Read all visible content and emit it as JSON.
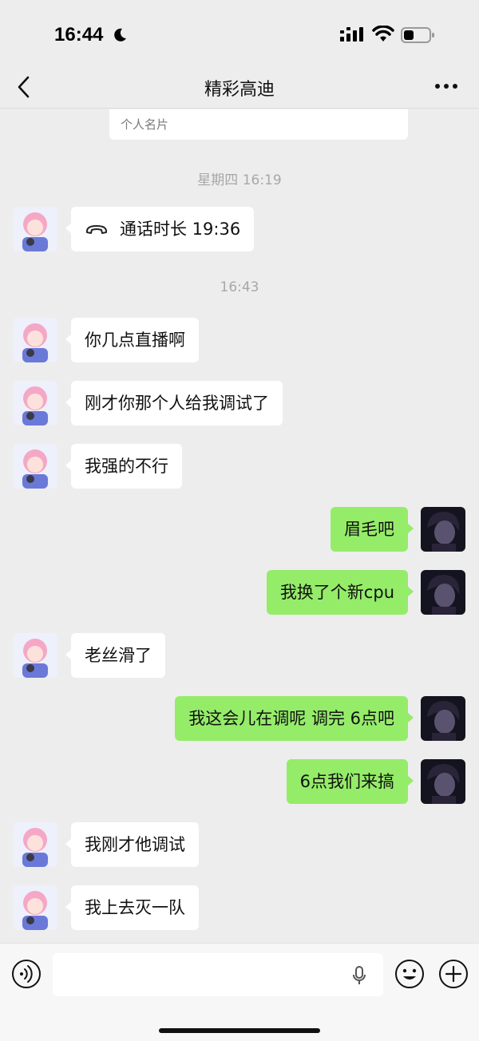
{
  "status_bar": {
    "time": "16:44"
  },
  "nav": {
    "title": "精彩高迪"
  },
  "card_peek": {
    "label": "个人名片"
  },
  "messages": [
    {
      "type": "timestamp",
      "text": "星期四 16:19"
    },
    {
      "type": "call",
      "side": "in",
      "text": "通话时长 19:36"
    },
    {
      "type": "timestamp",
      "text": "16:43"
    },
    {
      "type": "text",
      "side": "in",
      "text": "你几点直播啊"
    },
    {
      "type": "text",
      "side": "in",
      "text": "刚才你那个人给我调试了"
    },
    {
      "type": "text",
      "side": "in",
      "text": "我强的不行"
    },
    {
      "type": "text",
      "side": "out",
      "text": "眉毛吧"
    },
    {
      "type": "text",
      "side": "out",
      "text": "我换了个新cpu"
    },
    {
      "type": "text",
      "side": "in",
      "text": "老丝滑了"
    },
    {
      "type": "text",
      "side": "out",
      "text": "我这会儿在调呢 调完 6点吧"
    },
    {
      "type": "text",
      "side": "out",
      "text": "6点我们来搞"
    },
    {
      "type": "text",
      "side": "in",
      "text": "我刚才他调试"
    },
    {
      "type": "text",
      "side": "in",
      "text": "我上去灭一队"
    }
  ],
  "input_bar": {
    "value": ""
  },
  "colors": {
    "outgoing_bubble": "#95ec69",
    "incoming_bubble": "#ffffff",
    "background": "#ededed"
  },
  "icons": [
    "moon-icon",
    "signal-icon",
    "wifi-icon",
    "battery-icon",
    "back-icon",
    "more-icon",
    "call-icon",
    "voice-icon",
    "mic-icon",
    "emoji-icon",
    "plus-icon"
  ]
}
